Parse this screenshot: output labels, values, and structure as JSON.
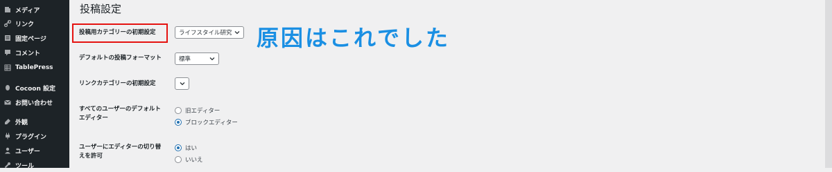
{
  "sidebar": {
    "items": [
      {
        "label": "メディア",
        "icon": "media-icon"
      },
      {
        "label": "リンク",
        "icon": "link-icon"
      },
      {
        "label": "固定ページ",
        "icon": "page-icon"
      },
      {
        "label": "コメント",
        "icon": "comment-icon"
      },
      {
        "label": "TablePress",
        "icon": "table-icon"
      },
      {
        "label": "Cocoon 設定",
        "icon": "cocoon-icon"
      },
      {
        "label": "お問い合わせ",
        "icon": "mail-icon"
      },
      {
        "label": "外観",
        "icon": "appearance-icon"
      },
      {
        "label": "プラグイン",
        "icon": "plugin-icon"
      },
      {
        "label": "ユーザー",
        "icon": "user-icon"
      },
      {
        "label": "ツール",
        "icon": "tools-icon"
      }
    ]
  },
  "page": {
    "title": "投稿設定",
    "fields": {
      "default_category": {
        "label": "投稿用カテゴリーの初期設定",
        "value": "ライフスタイル研究"
      },
      "default_format": {
        "label": "デフォルトの投稿フォーマット",
        "value": "標準"
      },
      "link_category": {
        "label": "リンクカテゴリーの初期設定",
        "value": ""
      },
      "default_editor": {
        "label_line1": "すべてのユーザーのデフォルト",
        "label_line2": "エディター",
        "options": [
          {
            "label": "旧エディター",
            "checked": false
          },
          {
            "label": "ブロックエディター",
            "checked": true
          }
        ]
      },
      "allow_switch": {
        "label_line1": "ユーザーにエディターの切り替",
        "label_line2": "えを許可",
        "options": [
          {
            "label": "はい",
            "checked": true
          },
          {
            "label": "いいえ",
            "checked": false
          }
        ]
      }
    }
  },
  "annotation": {
    "text": "原因はこれでした",
    "color": "#1a8fe3",
    "highlight_color": "#e5120f"
  }
}
